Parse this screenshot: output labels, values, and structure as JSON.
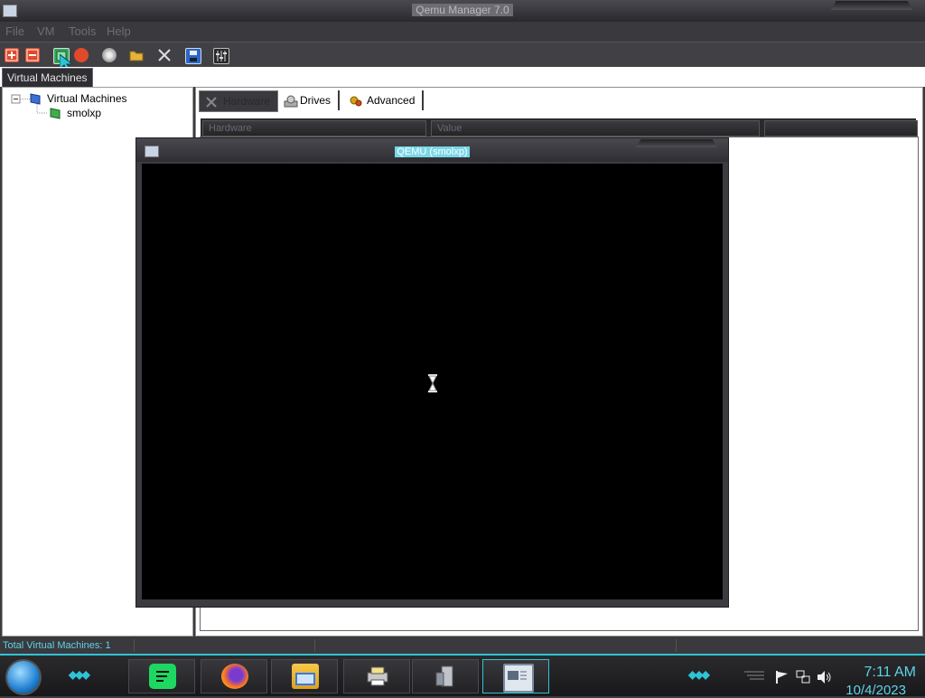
{
  "main_window": {
    "title": "Qemu Manager 7.0"
  },
  "menu": [
    "File",
    "VM",
    "Tools",
    "Help"
  ],
  "toolbar": {
    "icons": [
      "new-vm-icon",
      "delete-vm-icon",
      "start-vm-icon",
      "stop-vm-icon",
      "disc-icon",
      "open-folder-icon",
      "tools-icon",
      "save-icon",
      "settings-icon"
    ]
  },
  "left_tab": {
    "label": "Virtual Machines"
  },
  "tree": {
    "root": "Virtual Machines",
    "children": [
      "smolxp"
    ]
  },
  "inner_tabs": [
    "Hardware",
    "Drives",
    "Advanced"
  ],
  "table_headers": [
    "Hardware",
    "Value",
    ""
  ],
  "status": {
    "text": "Total Virtual Machines: 1"
  },
  "qemu_window": {
    "title": "QEMU (smolxp)"
  },
  "taskbar": {
    "apps": [
      "spotify-icon",
      "firefox-icon",
      "file-manager-icon",
      "printer-icon",
      "system-icon",
      "window-icon"
    ]
  },
  "clock": {
    "time": "7:11 AM",
    "date": "10/4/2023"
  },
  "colors": {
    "accent": "#2ec4d6",
    "title_highlight": "#79d7e8",
    "clock_text": "#5fd3e8"
  }
}
